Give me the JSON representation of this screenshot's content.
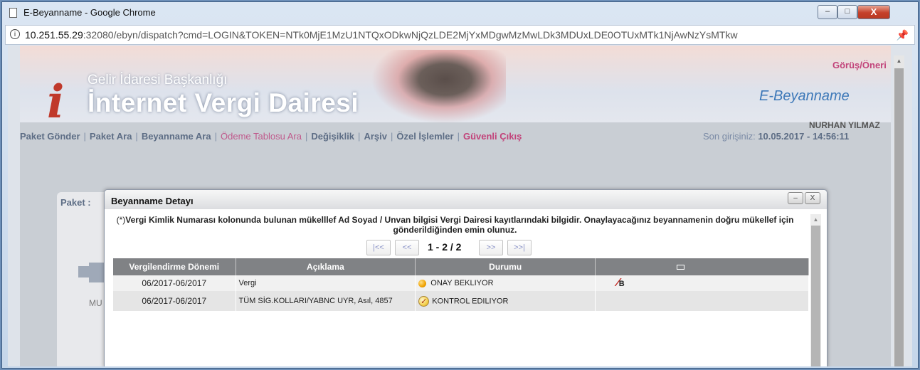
{
  "window": {
    "title": "E-Beyanname - Google Chrome",
    "minimize": "–",
    "maximize": "□",
    "close": "X"
  },
  "address": {
    "host": "10.251.55.29",
    "rest": ":32080/ebyn/dispatch?cmd=LOGIN&TOKEN=NTk0MjE1MzU1NTQxODkwNjQzLDE2MjYxMDgwMzMwLDk3MDUxLDE0OTUxMTk1NjAwNzYsMTkw"
  },
  "header": {
    "org": "Gelir İdaresi Başkanlığı",
    "brand": "İnternet Vergi Dairesi",
    "feedback": "Görüş/Öneri",
    "product": "E-Beyanname",
    "user": "NURHAN YILMAZ",
    "last_login_label": "Son girişiniz:",
    "last_login_value": "10.05.2017 - 14:56:11"
  },
  "nav": {
    "items": [
      "Paket Gönder",
      "Paket Ara",
      "Beyanname Ara",
      "Ödeme Tablosu Ara",
      "Değişiklik",
      "Arşiv",
      "Özel İşlemler",
      "Güvenli Çıkış"
    ],
    "separator": "|"
  },
  "background": {
    "tab_label": "Paket :",
    "row_text": "MU"
  },
  "modal": {
    "title": "Beyanname Detayı",
    "min_btn": "–",
    "close_btn": "X",
    "notice_prefix": "(*)",
    "notice": "Vergi Kimlik Numarası kolonunda bulunan mükelllef Ad Soyad / Unvan bilgisi Vergi Dairesi kayıtlarındaki bilgidir. Onaylayacağınız beyannamenin doğru mükellef için gönderildiğinden emin olunuz.",
    "pager": {
      "first": "|<<",
      "prev": "<<",
      "text": "1 - 2 / 2",
      "next": ">>",
      "last": ">>|"
    },
    "columns": [
      "Vergilendirme Dönemi",
      "Açıklama",
      "Durumu"
    ],
    "rows": [
      {
        "period": "06/2017-06/2017",
        "desc": "Vergi",
        "status": "ONAY BEKLIYOR",
        "pdf_label": "B"
      },
      {
        "period": "06/2017-06/2017",
        "desc": "TÜM SİG.KOLLARI/YABNC UYR, Asıl, 4857",
        "status": "KONTROL EDILIYOR"
      }
    ]
  },
  "icons": {
    "mail": "mail-icon",
    "pdf": "pdf-icon",
    "pending": "pending-dot-icon",
    "checking": "checking-clock-icon"
  },
  "colors": {
    "accent_pink": "#c2437a",
    "brand_red": "#c0392b",
    "nav_text": "#5d6d85",
    "table_header": "#808285"
  }
}
